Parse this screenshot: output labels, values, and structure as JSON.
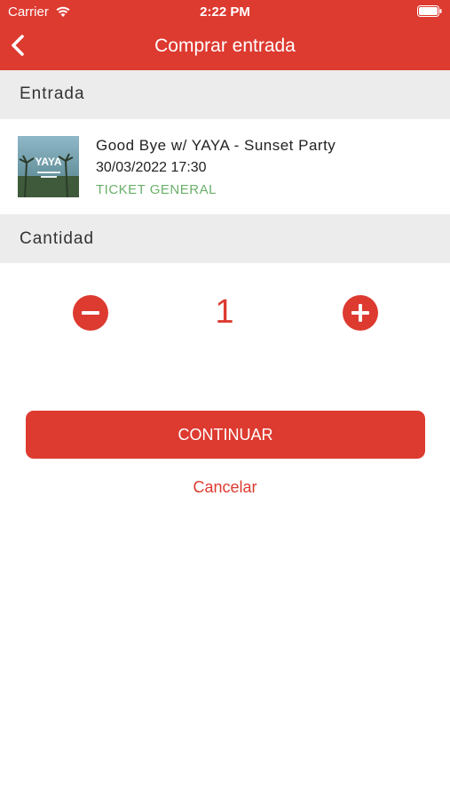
{
  "status_bar": {
    "carrier": "Carrier",
    "time": "2:22 PM"
  },
  "nav": {
    "title": "Comprar entrada"
  },
  "section_entrada": {
    "label": "Entrada"
  },
  "ticket": {
    "event_title": "Good Bye w/ YAYA - Sunset Party",
    "datetime": "30/03/2022 17:30",
    "type": "TICKET GENERAL",
    "thumbnail_text": "YAYA"
  },
  "section_cantidad": {
    "label": "Cantidad"
  },
  "quantity": {
    "value": "1"
  },
  "actions": {
    "continue_label": "CONTINUAR",
    "cancel_label": "Cancelar"
  },
  "colors": {
    "accent": "#dd3a30",
    "ticket_type": "#6ab06a",
    "section_bg": "#ececec"
  }
}
